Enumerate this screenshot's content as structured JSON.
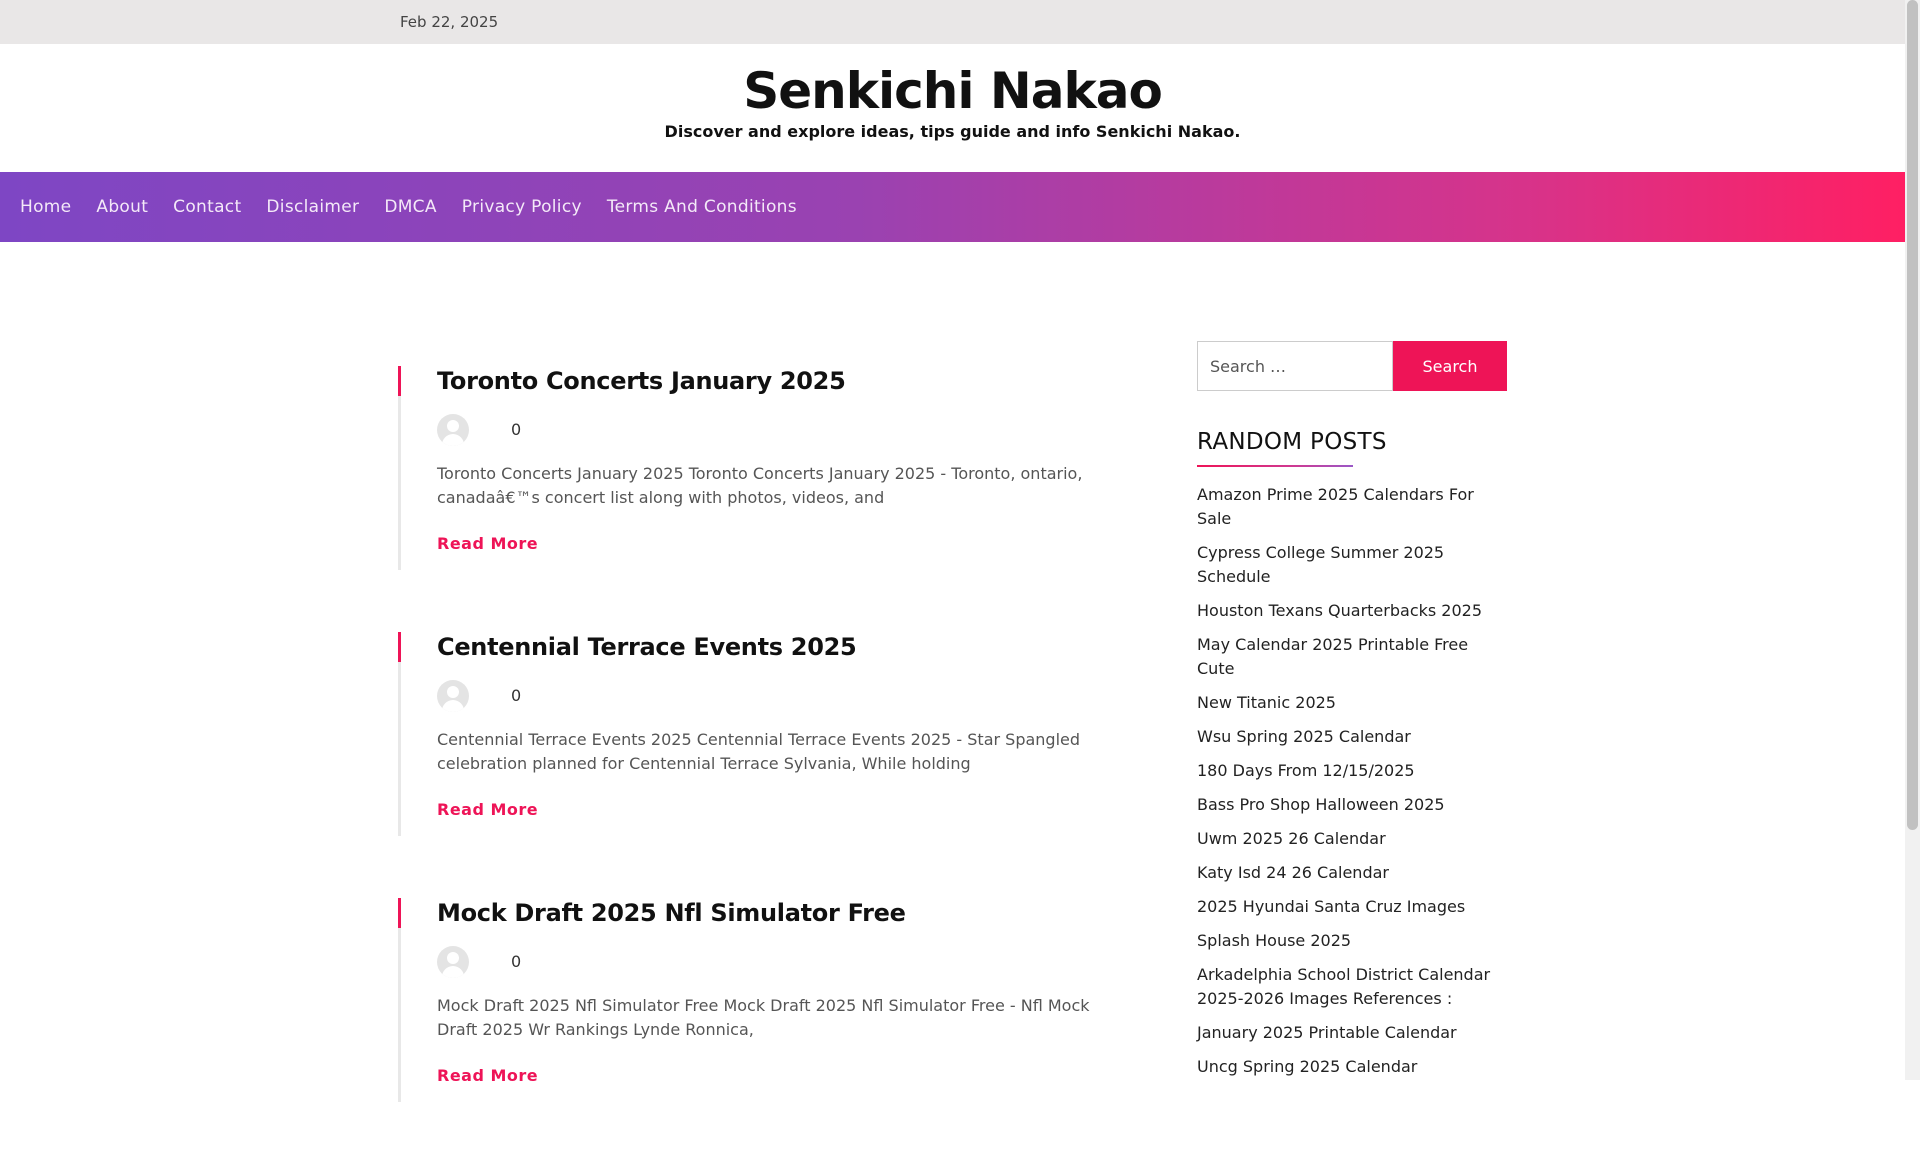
{
  "topbar": {
    "date": "Feb 22, 2025"
  },
  "header": {
    "title": "Senkichi Nakao",
    "tagline": "Discover and explore ideas, tips guide and info Senkichi Nakao."
  },
  "nav": {
    "items": [
      "Home",
      "About",
      "Contact",
      "Disclaimer",
      "DMCA",
      "Privacy Policy",
      "Terms And Conditions"
    ]
  },
  "posts": [
    {
      "title": "Toronto Concerts January 2025",
      "comments": "0",
      "excerpt": "Toronto Concerts January 2025 Toronto Concerts January 2025 - Toronto, ontario, canadaâ€™s concert list along with photos, videos, and",
      "read_more": "Read More"
    },
    {
      "title": "Centennial Terrace Events 2025",
      "comments": "0",
      "excerpt": "Centennial Terrace Events 2025 Centennial Terrace Events 2025 - Star Spangled celebration planned for Centennial Terrace Sylvania, While holding",
      "read_more": "Read More"
    },
    {
      "title": "Mock Draft 2025 Nfl Simulator Free",
      "comments": "0",
      "excerpt": "Mock Draft 2025 Nfl Simulator Free Mock Draft 2025 Nfl Simulator Free - Nfl Mock Draft 2025 Wr Rankings Lynde Ronnica,",
      "read_more": "Read More"
    }
  ],
  "sidebar": {
    "search_placeholder": "Search …",
    "search_button": "Search",
    "random_posts_title": "RANDOM POSTS",
    "random_posts": [
      "Amazon Prime 2025 Calendars For Sale",
      "Cypress College Summer 2025 Schedule",
      "Houston Texans Quarterbacks 2025",
      "May Calendar 2025 Printable Free Cute",
      "New Titanic 2025",
      "Wsu Spring 2025 Calendar",
      "180 Days From 12/15/2025",
      "Bass Pro Shop Halloween 2025",
      "Uwm 2025 26 Calendar",
      "Katy Isd 24 26 Calendar",
      "2025 Hyundai Santa Cruz Images",
      "Splash House 2025",
      "Arkadelphia School District Calendar 2025-2026 Images References :",
      "January 2025 Printable Calendar",
      "Uncg Spring 2025 Calendar"
    ]
  },
  "colors": {
    "accent": "#ee1457",
    "nav_start": "#7e46c4",
    "nav_end": "#ff1f63"
  }
}
